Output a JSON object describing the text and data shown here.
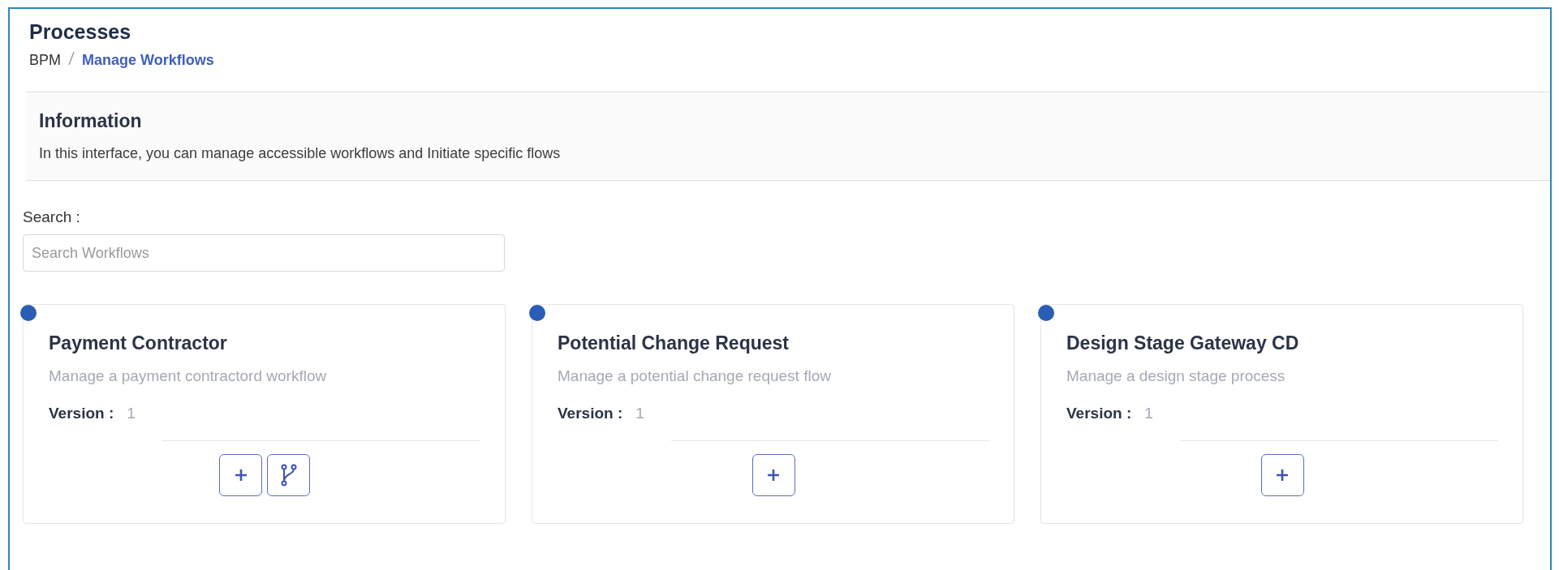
{
  "page": {
    "title": "Processes"
  },
  "breadcrumb": [
    {
      "label": "BPM",
      "current": false
    },
    {
      "label": "Manage Workflows",
      "current": true
    }
  ],
  "information": {
    "title": "Information",
    "text": "In this interface, you can manage accessible workflows and Initiate specific flows"
  },
  "search": {
    "label": "Search :",
    "placeholder": "Search Workflows"
  },
  "workflows": [
    {
      "title": "Payment Contractor",
      "description": "Manage a payment contractord workflow",
      "version_label": "Version :",
      "version": "1",
      "color": "#2a5db5",
      "actions": [
        {
          "kind": "add"
        },
        {
          "kind": "branch"
        }
      ]
    },
    {
      "title": "Potential Change Request",
      "description": "Manage a potential change request flow",
      "version_label": "Version :",
      "version": "1",
      "color": "#2a5db5",
      "actions": [
        {
          "kind": "add"
        }
      ]
    },
    {
      "title": "Design Stage Gateway CD",
      "description": "Manage a design stage process",
      "version_label": "Version :",
      "version": "1",
      "color": "#2a5db5",
      "actions": [
        {
          "kind": "add"
        }
      ]
    }
  ]
}
